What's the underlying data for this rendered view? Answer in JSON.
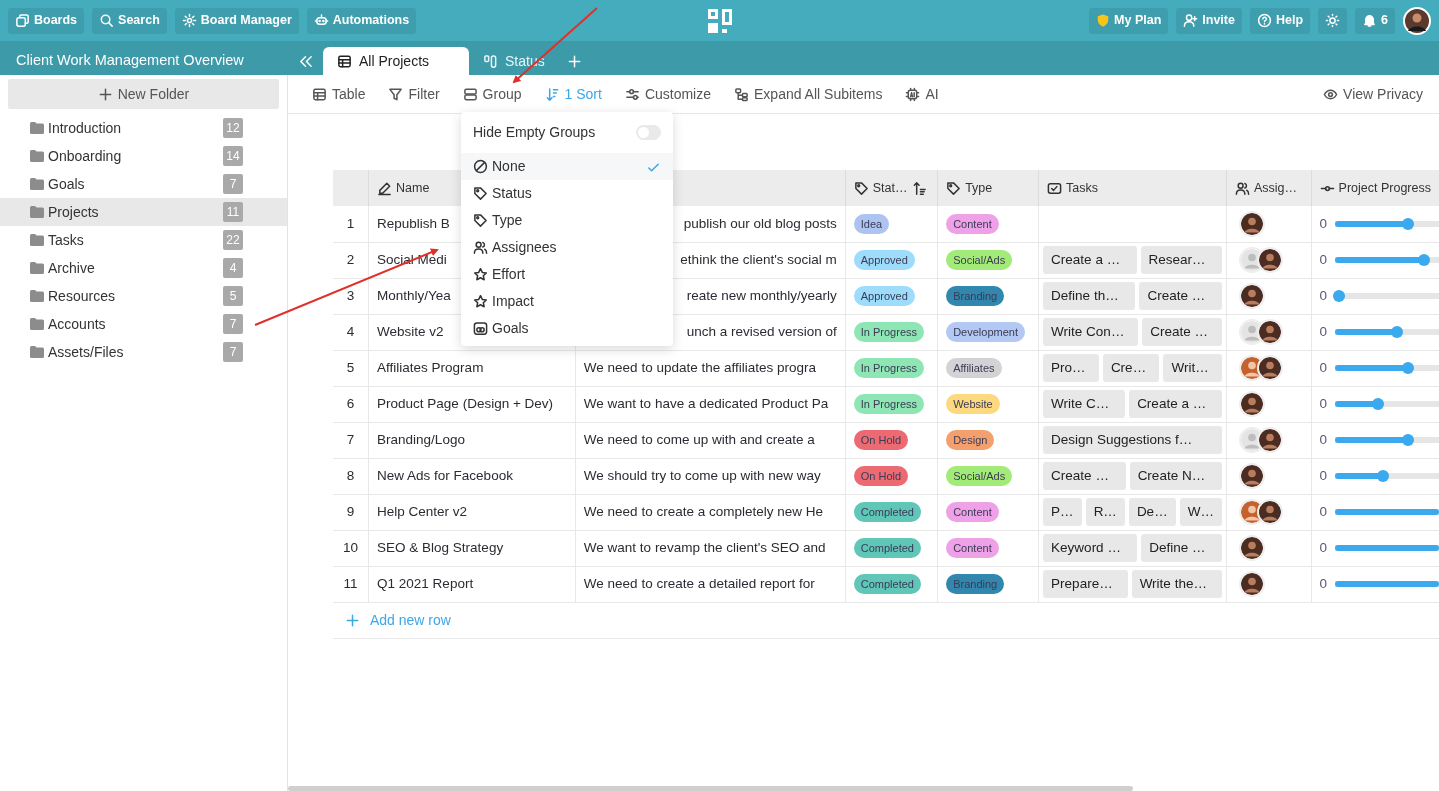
{
  "top_nav": {
    "left_buttons": [
      {
        "label": "Boards"
      },
      {
        "label": "Search"
      },
      {
        "label": "Board Manager"
      },
      {
        "label": "Automations"
      }
    ],
    "right_buttons": [
      {
        "label": "My Plan"
      },
      {
        "label": "Invite"
      },
      {
        "label": "Help"
      }
    ],
    "notifications": "6"
  },
  "board_title": "Client Work Management Overview",
  "tabs": [
    {
      "label": "All Projects",
      "selected": true
    },
    {
      "label": "Status",
      "selected": false
    }
  ],
  "sidebar": {
    "new_folder": "New Folder",
    "folders": [
      {
        "name": "Introduction",
        "count": "12",
        "selected": false
      },
      {
        "name": "Onboarding",
        "count": "14",
        "selected": false
      },
      {
        "name": "Goals",
        "count": "7",
        "selected": false
      },
      {
        "name": "Projects",
        "count": "11",
        "selected": true
      },
      {
        "name": "Tasks",
        "count": "22",
        "selected": false
      },
      {
        "name": "Archive",
        "count": "4",
        "selected": false
      },
      {
        "name": "Resources",
        "count": "5",
        "selected": false
      },
      {
        "name": "Accounts",
        "count": "7",
        "selected": false
      },
      {
        "name": "Assets/Files",
        "count": "7",
        "selected": false
      }
    ]
  },
  "toolbar": {
    "items": [
      {
        "label": "Table",
        "active": false
      },
      {
        "label": "Filter",
        "active": false
      },
      {
        "label": "Group",
        "active": false
      },
      {
        "label": "1 Sort",
        "active": true
      },
      {
        "label": "Customize",
        "active": false
      },
      {
        "label": "Expand All Subitems",
        "active": false
      },
      {
        "label": "AI",
        "active": false
      }
    ],
    "view_privacy": "View Privacy"
  },
  "group_menu": {
    "hide_empty_groups": {
      "label": "Hide Empty Groups",
      "on": false
    },
    "options": [
      {
        "label": "None",
        "selected": true
      },
      {
        "label": "Status",
        "selected": false
      },
      {
        "label": "Type",
        "selected": false
      },
      {
        "label": "Assignees",
        "selected": false
      },
      {
        "label": "Effort",
        "selected": false
      },
      {
        "label": "Impact",
        "selected": false
      },
      {
        "label": "Goals",
        "selected": false
      }
    ]
  },
  "table": {
    "columns": {
      "name": "Name",
      "status": "Stat…",
      "type": "Type",
      "tasks": "Tasks",
      "assignees": "Assig…",
      "progress": "Project Progress"
    },
    "rows": [
      {
        "number": "1",
        "name": "Republish B",
        "description": "publish our old blog posts",
        "covered": true,
        "status": {
          "label": "Idea",
          "color": "#aec4f0"
        },
        "type": {
          "label": "Content",
          "color": "#efa1e8"
        },
        "tasks": [],
        "assignees": [
          {
            "kind": "photo"
          }
        ],
        "progress": "0",
        "level": 0.7
      },
      {
        "number": "2",
        "name": "Social Medi",
        "description": "ethink the client's social m",
        "covered": true,
        "status": {
          "label": "Approved",
          "color": "#9edcfc"
        },
        "type": {
          "label": "Social/Ads",
          "color": "#a2eb78"
        },
        "tasks": [
          "Create a …",
          "Resear…"
        ],
        "assignees": [
          {
            "kind": "blank"
          },
          {
            "kind": "photo"
          }
        ],
        "progress": "0",
        "level": 0.86
      },
      {
        "number": "3",
        "name": "Monthly/Yea",
        "description": "reate new monthly/yearly",
        "covered": true,
        "status": {
          "label": "Approved",
          "color": "#9edcfc"
        },
        "type": {
          "label": "Branding",
          "color": "#3187ad"
        },
        "tasks": [
          "Define th…",
          "Create …"
        ],
        "assignees": [
          {
            "kind": "photo"
          }
        ],
        "progress": "0",
        "level": 0.04
      },
      {
        "number": "4",
        "name": "Website v2",
        "description": "unch a revised version of",
        "covered": true,
        "status": {
          "label": "In Progress",
          "color": "#8ee6b4"
        },
        "type": {
          "label": "Development",
          "color": "#b3c8f2"
        },
        "tasks": [
          "Write Con…",
          "Create …"
        ],
        "assignees": [
          {
            "kind": "blank"
          },
          {
            "kind": "photo"
          }
        ],
        "progress": "0",
        "level": 0.6
      },
      {
        "number": "5",
        "name": "Affiliates Program",
        "description": "We need to update the affiliates progra",
        "covered": false,
        "status": {
          "label": "In Progress",
          "color": "#8ee6b4"
        },
        "type": {
          "label": "Affiliates",
          "color": "#d3d3d6"
        },
        "tasks": [
          "Pro…",
          "Cre…",
          "Writ…"
        ],
        "assignees": [
          {
            "kind": "photo_alt"
          },
          {
            "kind": "photo"
          }
        ],
        "progress": "0",
        "level": 0.7
      },
      {
        "number": "6",
        "name": "Product Page (Design + Dev)",
        "description": "We want to have a dedicated Product Pa",
        "covered": false,
        "status": {
          "label": "In Progress",
          "color": "#8ee6b4"
        },
        "type": {
          "label": "Website",
          "color": "#fcd97f"
        },
        "tasks": [
          "Write C…",
          "Create a …"
        ],
        "assignees": [
          {
            "kind": "photo"
          }
        ],
        "progress": "0",
        "level": 0.41
      },
      {
        "number": "7",
        "name": "Branding/Logo",
        "description": "We need to come up with and create a",
        "covered": false,
        "status": {
          "label": "On Hold",
          "color": "#ec6a72"
        },
        "type": {
          "label": "Design",
          "color": "#f3a06e"
        },
        "tasks": [
          "Design Suggestions f…"
        ],
        "assignees": [
          {
            "kind": "blank"
          },
          {
            "kind": "photo"
          }
        ],
        "progress": "0",
        "level": 0.7
      },
      {
        "number": "8",
        "name": "New Ads for Facebook",
        "description": "We should try to come up with new way",
        "covered": false,
        "status": {
          "label": "On Hold",
          "color": "#ec6a72"
        },
        "type": {
          "label": "Social/Ads",
          "color": "#a2eb78"
        },
        "tasks": [
          "Create …",
          "Create N…"
        ],
        "assignees": [
          {
            "kind": "photo"
          }
        ],
        "progress": "0",
        "level": 0.46
      },
      {
        "number": "9",
        "name": "Help Center v2",
        "description": "We need to create a completely new He",
        "covered": false,
        "status": {
          "label": "Completed",
          "color": "#5fc6b8"
        },
        "type": {
          "label": "Content",
          "color": "#efa1e8"
        },
        "tasks": [
          "P…",
          "R…",
          "De…",
          "W…"
        ],
        "assignees": [
          {
            "kind": "photo_alt"
          },
          {
            "kind": "photo"
          }
        ],
        "progress": "0",
        "level": 1
      },
      {
        "number": "10",
        "name": "SEO & Blog Strategy",
        "description": "We want to revamp the client's SEO and",
        "covered": false,
        "status": {
          "label": "Completed",
          "color": "#5fc6b8"
        },
        "type": {
          "label": "Content",
          "color": "#efa1e8"
        },
        "tasks": [
          "Keyword …",
          "Define …"
        ],
        "assignees": [
          {
            "kind": "photo"
          }
        ],
        "progress": "0",
        "level": 1
      },
      {
        "number": "11",
        "name": "Q1 2021 Report",
        "description": "We need to create a detailed report for",
        "covered": false,
        "status": {
          "label": "Completed",
          "color": "#5fc6b8"
        },
        "type": {
          "label": "Branding",
          "color": "#3187ad"
        },
        "tasks": [
          "Prepare…",
          "Write the…"
        ],
        "assignees": [
          {
            "kind": "photo"
          }
        ],
        "progress": "0",
        "level": 1
      }
    ],
    "add_row": "Add new row"
  }
}
